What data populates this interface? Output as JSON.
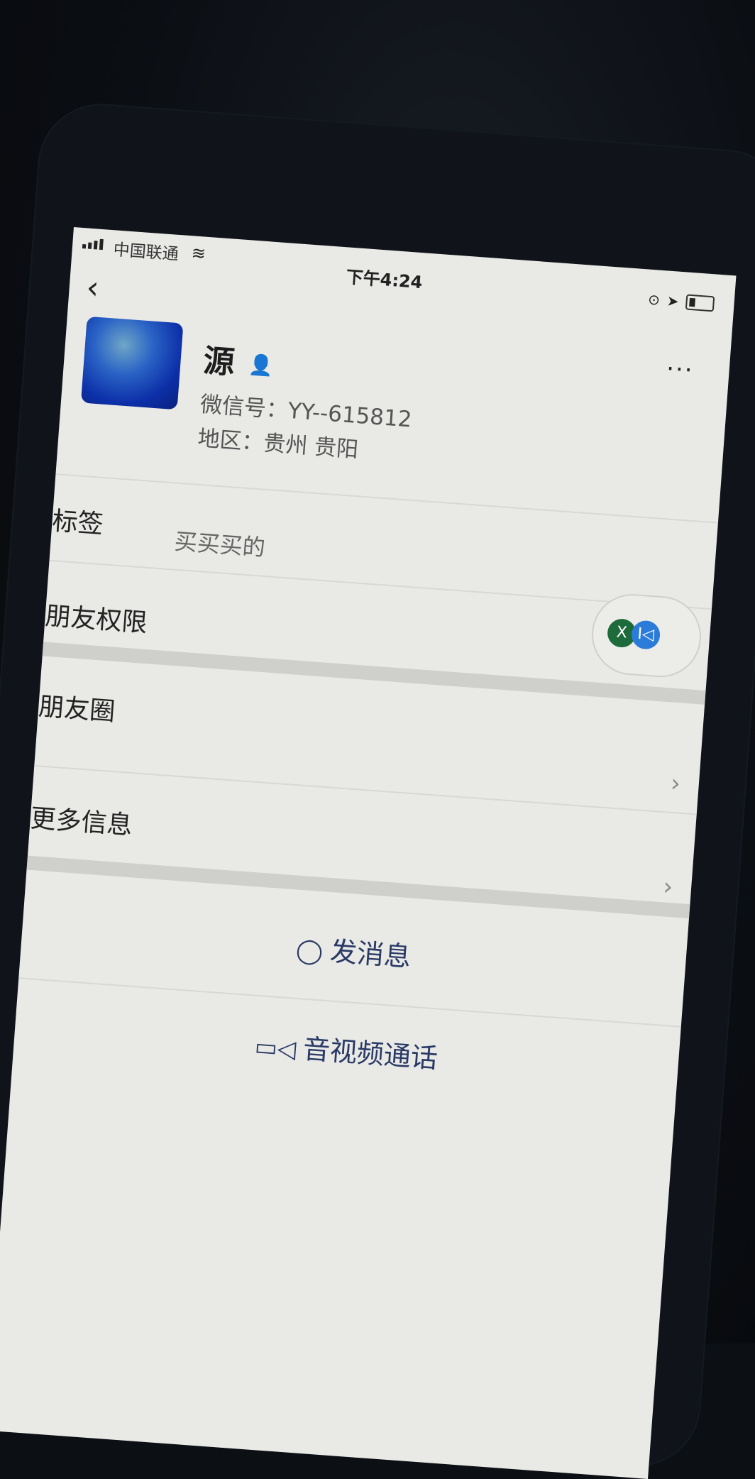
{
  "statusbar": {
    "carrier": "中国联通",
    "time": "下午4:24",
    "icons": [
      "signal-icon",
      "wifi-icon",
      "rotation-lock-icon",
      "location-icon",
      "battery-icon"
    ]
  },
  "header": {
    "back_icon": "chevron-left-icon",
    "more_icon": "more-dots-icon"
  },
  "profile": {
    "name": "源",
    "wechat_id": "微信号：YY--615812",
    "region": "地区：贵州 贵阳",
    "contact_icon": "person-icon"
  },
  "rows": {
    "tag_label": "标签",
    "tag_value": "买买买的",
    "friend_permission": "朋友权限",
    "moments": "朋友圈",
    "more_info": "更多信息"
  },
  "floating": {
    "left_glyph": "X",
    "right_glyph": "I◁"
  },
  "actions": {
    "send_message": "发消息",
    "av_call": "音视频通话"
  }
}
